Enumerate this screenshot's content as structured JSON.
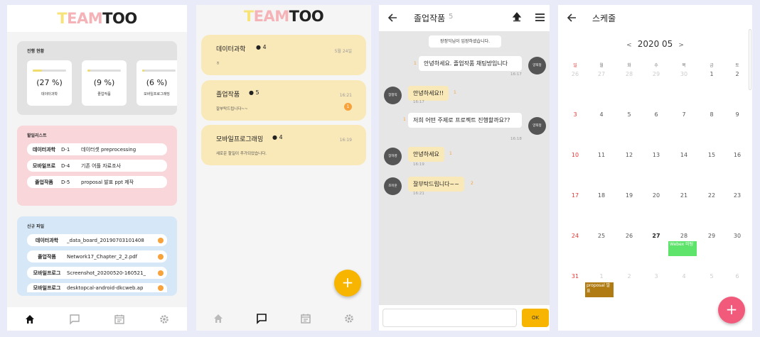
{
  "logo": {
    "p1": "T",
    "p2": "EAM",
    "p3": "TOO"
  },
  "home": {
    "progress_title": "진행 현황",
    "progress": [
      {
        "value": "(27 %)",
        "name": "데이터과학",
        "fill": 0.27
      },
      {
        "value": "(9 %)",
        "name": "졸업작품",
        "fill": 0.09
      },
      {
        "value": "(6 %)",
        "name": "모바일프로그래밍",
        "fill": 0.06
      }
    ],
    "todo_title": "할일리스트",
    "todos": [
      {
        "project": "데이터과학",
        "dday": "D-1",
        "task": "데이터셋 preprocessing"
      },
      {
        "project": "모바일프로",
        "dday": "D-4",
        "task": "기존 어플 자료조사"
      },
      {
        "project": "졸업작품",
        "dday": "D-5",
        "task": "proposal 발표 ppt 제작"
      }
    ],
    "files_title": "신규 파일",
    "files": [
      {
        "project": "데이터과학",
        "file": "_data_board_20190703101408"
      },
      {
        "project": "졸업작품",
        "file": "Network17_Chapter_2_2.pdf"
      },
      {
        "project": "모바일프로그",
        "file": "Screenshot_20200520-160521_"
      },
      {
        "project": "모바일프로그",
        "file": "desktopcal-android-dkcweb.ap"
      }
    ]
  },
  "rooms": [
    {
      "name": "데이터과학",
      "members": "4",
      "last": "ㅎ",
      "time": "5월 24일",
      "badge": ""
    },
    {
      "name": "졸업작품",
      "members": "5",
      "last": "잘부탁드립니다~~",
      "time": "16:21",
      "badge": "1"
    },
    {
      "name": "모바일프로그래밍",
      "members": "4",
      "last": "새로운 할일이 추가되었습니다.",
      "time": "16:19",
      "badge": ""
    }
  ],
  "chat": {
    "title": "졸업작품",
    "count": "5",
    "system": "장정익님이 입장하셨습니다.",
    "messages": [
      {
        "text": "안녕하세요. 졸업작품 채팅방입니다",
        "unread": "1",
        "time": "16:17",
        "avatar": "양희정"
      },
      {
        "text": "안녕하세요!!",
        "unread": "1",
        "time": "16:17",
        "avatar": "장정익"
      },
      {
        "text": "저희 어떤 주제로 프로젝트 진행할까요??",
        "unread": "1",
        "time": "16:18",
        "avatar": "양희정"
      },
      {
        "text": "안녕하세요",
        "unread": "1",
        "time": "16:19",
        "avatar": "장하영"
      },
      {
        "text": "잘부탁드립니다~~",
        "unread": "2",
        "time": "16:21",
        "avatar": "조미훈"
      }
    ],
    "send_label": "OK"
  },
  "schedule": {
    "title": "스케줄",
    "month": "2020 05",
    "prev": "<",
    "next": ">",
    "weekdays": [
      "일",
      "월",
      "화",
      "수",
      "목",
      "금",
      "토"
    ],
    "weeks": [
      [
        "26",
        "27",
        "28",
        "29",
        "30",
        "1",
        "2"
      ],
      [
        "3",
        "4",
        "5",
        "6",
        "7",
        "8",
        "9"
      ],
      [
        "10",
        "11",
        "12",
        "13",
        "14",
        "15",
        "16"
      ],
      [
        "17",
        "18",
        "19",
        "20",
        "21",
        "22",
        "23"
      ],
      [
        "24",
        "25",
        "26",
        "27",
        "28",
        "29",
        "30"
      ],
      [
        "31",
        "1",
        "2",
        "3",
        "4",
        "5",
        "6"
      ]
    ],
    "events": [
      {
        "title": "Webex 미팅",
        "color": "#5ee36b"
      },
      {
        "title": "proposal 발표",
        "color": "#b07b12"
      }
    ]
  },
  "colors": {
    "accent": "#f7b500",
    "pink_fab": "#f25a7c",
    "room": "#fae9b8",
    "todo_bg": "#f9d6d9",
    "files_bg": "#d6e8f7"
  }
}
